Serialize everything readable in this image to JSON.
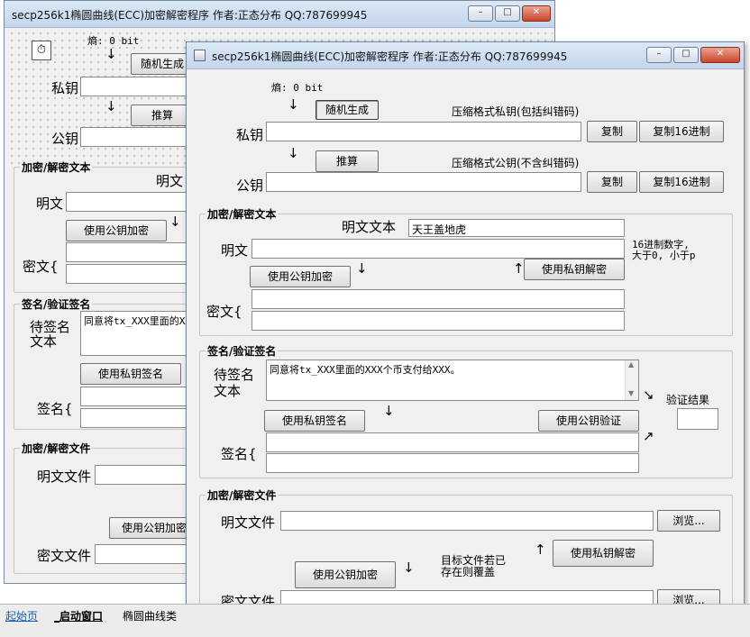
{
  "back_window": {
    "title": "secp256k1椭圆曲线(ECC)加密解密程序 作者:正态分布 QQ:787699945",
    "entropy_label": "熵: 0 bit",
    "random_btn": "随机生成",
    "private_key_label": "私钥",
    "derive_btn": "推算",
    "public_key_label": "公钥",
    "text_group_title": "加密/解密文本",
    "plain_text_caption": "明文",
    "plain_label": "明文",
    "encrypt_pub_btn": "使用公钥加密",
    "cipher_label": "密文{",
    "sign_group_title": "签名/验证签名",
    "to_sign_label": "待签名\n文本",
    "to_sign_value": "同意将tx_XXX里面的XX",
    "sign_priv_btn": "使用私钥签名",
    "signature_label": "签名{",
    "file_group_title": "加密/解密文件",
    "plain_file_label": "明文文件",
    "encrypt_file_btn": "使用公钥加密",
    "cipher_file_label": "密文文件"
  },
  "front_window": {
    "title": "secp256k1椭圆曲线(ECC)加密解密程序 作者:正态分布 QQ:787699945",
    "entropy_label": "熵: 0 bit",
    "random_btn": "随机生成",
    "priv_compressed_note": "压缩格式私钥(包括纠错码)",
    "private_key_label": "私钥",
    "private_key_value": "",
    "copy_btn": "复制",
    "copy_hex_btn": "复制16进制",
    "derive_btn": "推算",
    "pub_compressed_note": "压缩格式公钥(不含纠错码)",
    "public_key_label": "公钥",
    "public_key_value": "",
    "text_group_title": "加密/解密文本",
    "plain_text_caption": "明文文本",
    "plain_text_value": "天王盖地虎",
    "plain_label": "明文",
    "plain_value": "",
    "hex_note_line1": "16进制数字,",
    "hex_note_line2": "大于0, 小于p",
    "encrypt_pub_btn": "使用公钥加密",
    "decrypt_priv_btn": "使用私钥解密",
    "cipher_label": "密文{",
    "sign_group_title": "签名/验证签名",
    "to_sign_label_l1": "待签名",
    "to_sign_label_l2": "文本",
    "to_sign_value": "同意将tx_XXX里面的XXX个币支付给XXX。",
    "sign_priv_btn": "使用私钥签名",
    "verify_pub_btn": "使用公钥验证",
    "verify_result_label": "验证结果",
    "signature_label": "签名{",
    "file_group_title": "加密/解密文件",
    "plain_file_label": "明文文件",
    "browse_btn": "浏览...",
    "overwrite_note_l1": "目标文件若已",
    "overwrite_note_l2": "存在则覆盖",
    "decrypt_file_btn": "使用私钥解密",
    "encrypt_file_btn": "使用公钥加密",
    "cipher_file_label": "密文文件"
  },
  "taskbar": {
    "tabs": [
      "起始页",
      "_启动窗口",
      "椭圆曲线类"
    ]
  },
  "icons": {
    "down_arrow": "↓",
    "up_arrow": "↑",
    "diag_down": "↘",
    "diag_up": "↗",
    "minimize": "–",
    "maximize": "□",
    "close": "✕"
  }
}
